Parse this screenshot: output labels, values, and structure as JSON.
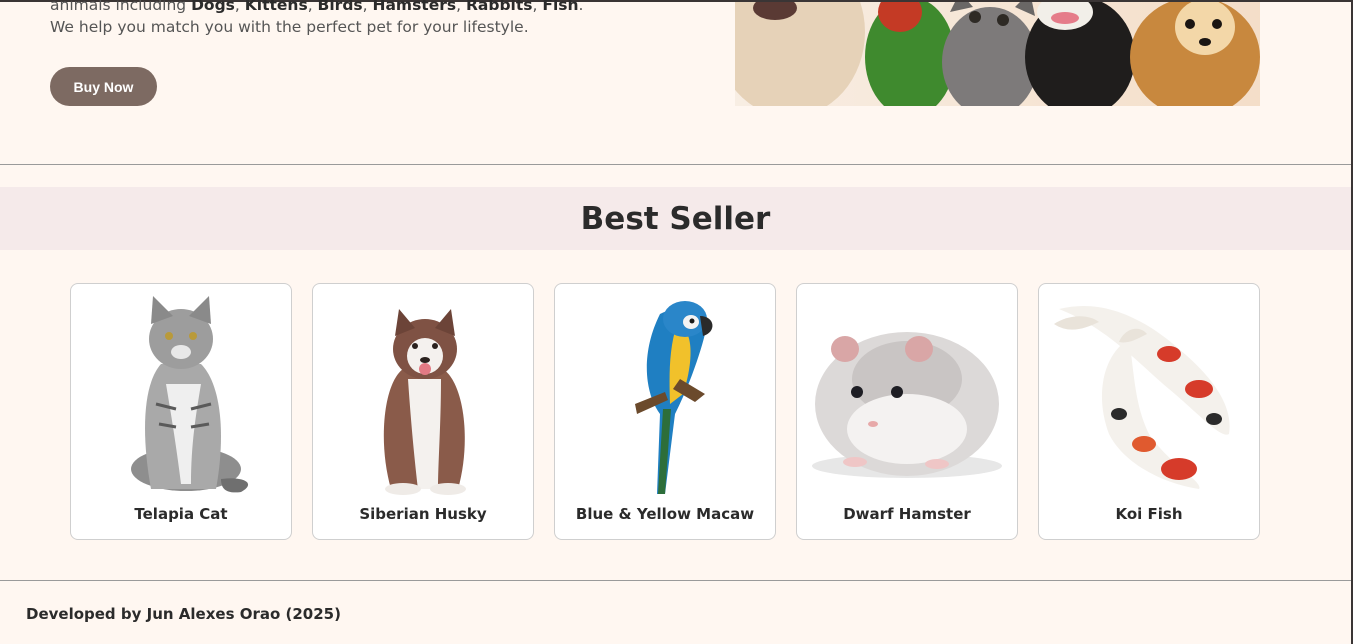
{
  "hero": {
    "text_prefix": "animals including ",
    "animals": [
      "Dogs",
      "Kittens",
      "Birds",
      "Hamsters",
      "Rabbits",
      "Fish"
    ],
    "text_suffix": ". We help you match you with the perfect pet for your lifestyle.",
    "buy_label": "Buy Now",
    "button_color": "#7d6a62"
  },
  "best_seller": {
    "title": "Best Seller",
    "products": [
      {
        "name": "Telapia Cat"
      },
      {
        "name": "Siberian Husky"
      },
      {
        "name": "Blue & Yellow Macaw"
      },
      {
        "name": "Dwarf Hamster"
      },
      {
        "name": "Koi Fish"
      }
    ]
  },
  "footer": {
    "text": "Developed by Jun Alexes Orao (2025)"
  }
}
